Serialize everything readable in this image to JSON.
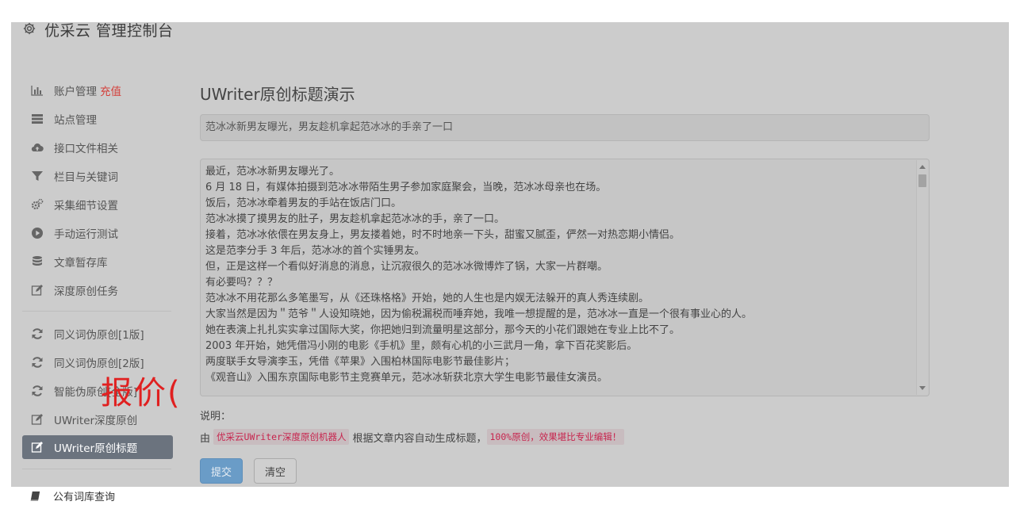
{
  "header": {
    "title": "优采云 管理控制台"
  },
  "sidebar": {
    "group1": [
      {
        "label": "账户管理",
        "badge": "充值",
        "icon": "bar-chart-icon"
      },
      {
        "label": "站点管理",
        "icon": "list-icon"
      },
      {
        "label": "接口文件相关",
        "icon": "cloud-upload-icon"
      },
      {
        "label": "栏目与关键词",
        "icon": "filter-icon"
      },
      {
        "label": "采集细节设置",
        "icon": "gears-icon"
      },
      {
        "label": "手动运行测试",
        "icon": "play-icon"
      },
      {
        "label": "文章暂存库",
        "icon": "database-icon"
      },
      {
        "label": "深度原创任务",
        "icon": "edit-icon"
      }
    ],
    "group2": [
      {
        "label": "同义词伪原创[1版]",
        "icon": "refresh-icon"
      },
      {
        "label": "同义词伪原创[2版]",
        "icon": "refresh-icon"
      },
      {
        "label": "智能伪原创[全版]",
        "icon": "refresh-icon"
      },
      {
        "label": "UWriter深度原创",
        "icon": "edit-icon"
      },
      {
        "label": "UWriter原创标题",
        "icon": "edit-icon"
      }
    ],
    "footer": {
      "label": "公有词库查询",
      "icon": "book-icon"
    }
  },
  "promo": "报价(",
  "main": {
    "heading": "UWriter原创标题演示",
    "title_value": "范冰冰新男友曝光，男友趁机拿起范冰冰的手亲了一口",
    "content_lines": [
      "最近，范冰冰新男友曝光了。",
      "6 月 18 日，有媒体拍摄到范冰冰带陌生男子参加家庭聚会，当晚，范冰冰母亲也在场。",
      "饭后，范冰冰牵着男友的手站在饭店门口。",
      "范冰冰摸了摸男友的肚子，男友趁机拿起范冰冰的手，亲了一口。",
      "接着，范冰冰依偎在男友身上，男友搂着她，时不时地亲一下头，甜蜜又腻歪，俨然一对热恋期小情侣。",
      "这是范李分手 3 年后，范冰冰的首个实锤男友。",
      "但，正是这样一个看似好消息的消息，让沉寂很久的范冰冰微博炸了锅，大家一片群嘲。",
      "有必要吗？？？",
      "范冰冰不用花那么多笔墨写，从《还珠格格》开始，她的人生也是内娱无法躲开的真人秀连续剧。",
      "大家当然是因为＂范爷＂人设知晓她，因为偷税漏税而唾弃她，我唯一想提醒的是，范冰冰一直是一个很有事业心的人。",
      "她在表演上扎扎实实拿过国际大奖，你把她归到流量明星这部分，那今天的小花们跟她在专业上比不了。",
      "2003 年开始，她凭借冯小刚的电影《手机》里，颇有心机的小三武月一角，拿下百花奖影后。",
      "两度联手女导演李玉，凭借《苹果》入围柏林国际电影节最佳影片；",
      "《观音山》入围东京国际电影节主竞赛单元，范冰冰斩获北京大学生电影节最佳女演员。"
    ],
    "notes_label": "说明：",
    "notes_prefix": "由",
    "notes_code1": "优采云UWriter深度原创机器人",
    "notes_middle": "根据文章内容自动生成标题，",
    "notes_code2": "100%原创，效果堪比专业编辑！",
    "submit_label": "提交",
    "clear_label": "清空"
  }
}
